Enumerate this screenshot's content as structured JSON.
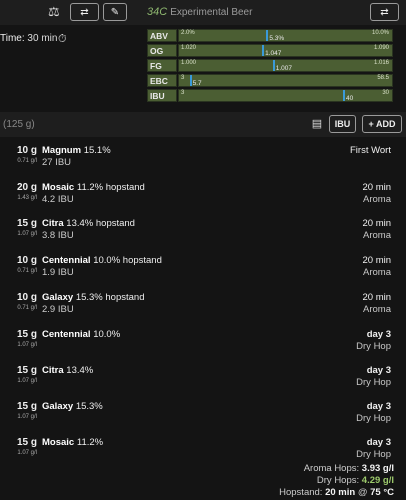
{
  "topbar": {
    "beer_name": "Experimental Beer",
    "logo_text": "34C",
    "icons": [
      "scale-icon",
      "swap-icon",
      "edit-icon",
      "swap-icon"
    ]
  },
  "time": {
    "label": "Time:",
    "value": "30 min"
  },
  "stats": [
    {
      "label": "ABV",
      "min": "2.0%",
      "max": "10.0%",
      "value": "5.3%",
      "fraction": 0.41
    },
    {
      "label": "OG",
      "min": "1.020",
      "max": "1.090",
      "value": "1.047",
      "fraction": 0.39
    },
    {
      "label": "FG",
      "min": "1.000",
      "max": "1.016",
      "value": "1.007",
      "fraction": 0.44
    },
    {
      "label": "EBC",
      "min": "3",
      "max": "58.5",
      "value": "5.7",
      "fraction": 0.05
    },
    {
      "label": "IBU",
      "min": "3",
      "max": "30",
      "value": "40",
      "fraction": 0.77
    }
  ],
  "hops_header": {
    "total": "(125 g)",
    "ibu_button": "IBU",
    "add_button": "+ ADD"
  },
  "hops": [
    {
      "amount": "10 g",
      "density": "0.71 g/l",
      "name": "Magnum",
      "alpha": "15.1%",
      "stage": "",
      "ibu": "27 IBU",
      "time": "First Wort",
      "time_bold": false,
      "use": ""
    },
    {
      "amount": "20 g",
      "density": "1.43 g/l",
      "name": "Mosaic",
      "alpha": "11.2%",
      "stage": "hopstand",
      "ibu": "4.2 IBU",
      "time": "20 min",
      "time_bold": false,
      "use": "Aroma"
    },
    {
      "amount": "15 g",
      "density": "1.07 g/l",
      "name": "Citra",
      "alpha": "13.4%",
      "stage": "hopstand",
      "ibu": "3.8 IBU",
      "time": "20 min",
      "time_bold": false,
      "use": "Aroma"
    },
    {
      "amount": "10 g",
      "density": "0.71 g/l",
      "name": "Centennial",
      "alpha": "10.0%",
      "stage": "hopstand",
      "ibu": "1.9 IBU",
      "time": "20 min",
      "time_bold": false,
      "use": "Aroma"
    },
    {
      "amount": "10 g",
      "density": "0.71 g/l",
      "name": "Galaxy",
      "alpha": "15.3%",
      "stage": "hopstand",
      "ibu": "2.9 IBU",
      "time": "20 min",
      "time_bold": false,
      "use": "Aroma"
    },
    {
      "amount": "15 g",
      "density": "1.07 g/l",
      "name": "Centennial",
      "alpha": "10.0%",
      "stage": "",
      "ibu": "",
      "time": "day 3",
      "time_bold": true,
      "use": "Dry Hop"
    },
    {
      "amount": "15 g",
      "density": "1.07 g/l",
      "name": "Citra",
      "alpha": "13.4%",
      "stage": "",
      "ibu": "",
      "time": "day 3",
      "time_bold": true,
      "use": "Dry Hop"
    },
    {
      "amount": "15 g",
      "density": "1.07 g/l",
      "name": "Galaxy",
      "alpha": "15.3%",
      "stage": "",
      "ibu": "",
      "time": "day 3",
      "time_bold": true,
      "use": "Dry Hop"
    },
    {
      "amount": "15 g",
      "density": "1.07 g/l",
      "name": "Mosaic",
      "alpha": "11.2%",
      "stage": "",
      "ibu": "",
      "time": "day 3",
      "time_bold": true,
      "use": "Dry Hop"
    }
  ],
  "summary": {
    "aroma_label": "Aroma Hops:",
    "aroma_value": "3.93 g/l",
    "dry_label": "Dry Hops:",
    "dry_value": "4.29 g/l",
    "hopstand_label": "Hopstand:",
    "hopstand_time": "20 min",
    "hopstand_at": "@",
    "hopstand_temp": "75 °C"
  },
  "colors": {
    "accent_green": "#4b5e33",
    "marker_blue": "#3a9ad9",
    "highlight_green": "#9cc96b"
  }
}
